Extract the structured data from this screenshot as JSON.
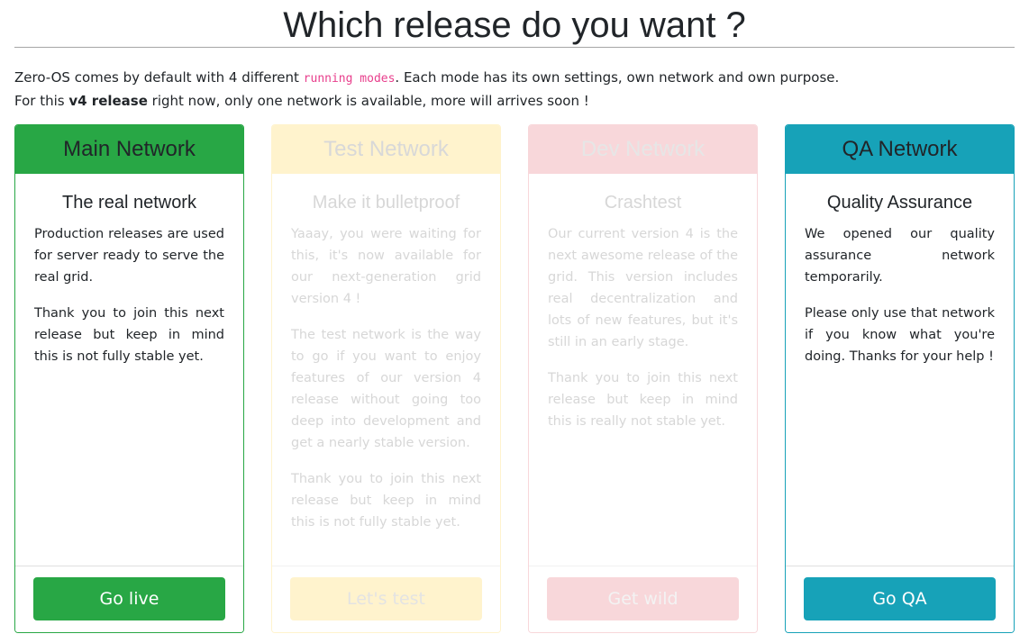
{
  "page": {
    "title": "Which release do you want ?",
    "intro": {
      "line1_before": "Zero-OS comes by default with 4 different ",
      "line1_code": "running modes",
      "line1_after": ". Each mode has its own settings, own network and own purpose.",
      "line2_before": "For this ",
      "line2_bold": "v4 release",
      "line2_after": " right now, only one network is available, more will arrives soon !"
    }
  },
  "cards": {
    "main": {
      "header": "Main Network",
      "title": "The real network",
      "paragraphs": [
        "Production releases are used for server ready to serve the real grid.",
        "Thank you to join this next release but keep in mind this is not fully stable yet."
      ],
      "button": "Go live",
      "color": "#28a745"
    },
    "test": {
      "header": "Test Network",
      "title": "Make it bulletproof",
      "paragraphs": [
        "Yaaay, you were waiting for this, it's now available for our next-generation grid version 4 !",
        "The test network is the way to go if you want to enjoy features of our version 4 release without going too deep into development and get a nearly stable version.",
        "Thank you to join this next release but keep in mind this is not fully stable yet."
      ],
      "button": "Let's test",
      "color": "#fff3cd"
    },
    "dev": {
      "header": "Dev Network",
      "title": "Crashtest",
      "paragraphs": [
        "Our current version 4 is the next awesome release of the grid. This version includes real decentralization and lots of new features, but it's still in an early stage.",
        "Thank you to join this next release but keep in mind this is really not stable yet."
      ],
      "button": "Get wild",
      "color": "#f8d7da"
    },
    "qa": {
      "header": "QA Network",
      "title": "Quality Assurance",
      "paragraphs": [
        "We opened our quality assurance network temporarily.",
        "Please only use that network if you know what you're doing. Thanks for your help !"
      ],
      "button": "Go QA",
      "color": "#17a2b8"
    }
  }
}
